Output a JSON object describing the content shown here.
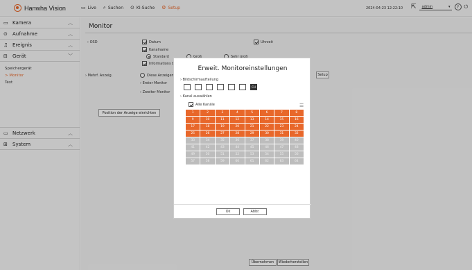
{
  "app": {
    "logo_text": "Hanwha Vision",
    "brand_color": "#e8672a"
  },
  "topmenu": [
    {
      "label": "Live",
      "icon": "monitor-icon"
    },
    {
      "label": "Suchen",
      "icon": "search-icon"
    },
    {
      "label": "KI-Suche",
      "icon": "ai-search-icon"
    },
    {
      "label": "Setup",
      "icon": "gear-icon"
    }
  ],
  "status": {
    "datetime": "2024-04-23 12:22:10",
    "user": "admin"
  },
  "sidebar": {
    "sections": [
      {
        "label": "Kamera",
        "icon": "camera-icon",
        "chevron": "^"
      },
      {
        "label": "Aufnahme",
        "icon": "record-icon",
        "chevron": "^"
      },
      {
        "label": "Ereignis",
        "icon": "bell-icon",
        "chevron": "^"
      },
      {
        "label": "Gerät",
        "icon": "device-icon",
        "chevron": "v"
      },
      {
        "label": "Netzwerk",
        "icon": "network-icon",
        "chevron": "^"
      },
      {
        "label": "System",
        "icon": "system-icon",
        "chevron": "^"
      }
    ],
    "sub": [
      "Speichergerät",
      "> Monitor",
      "Text"
    ]
  },
  "page": {
    "title": "Monitor",
    "osd_label": "› OSD",
    "datum": "Datum",
    "uhrzeit": "Uhrzeit",
    "kanalname": "Kanalname",
    "standard": "Standard",
    "gross": "Groß",
    "sehr_gross": "Sehr groß",
    "informationen": "Informations b",
    "mehrf_label": "› Mehrf. Anzeig.",
    "diese": "Diese Anzeigen b",
    "erster": "› Erster Monitor",
    "zweiter": "› Zweiter Monitor",
    "setup_btn": "Setup",
    "position_btn": "Position der Anzeige einrichten",
    "apply_btn": "Übernehmen",
    "restore_btn": "Wiederherstellen"
  },
  "modal": {
    "title": "Erweit. Monitoreinstellungen",
    "bildschirm": "› Bildschirmaufteilung",
    "kanal": "› Kanal auswählen",
    "alle": "Alle Kanäle",
    "ok": "Ok",
    "abbr": "Abbr.",
    "splits": [
      "",
      "",
      "",
      "",
      "",
      "",
      "CH"
    ],
    "channels_selected": [
      "1",
      "2",
      "3",
      "4",
      "5",
      "6",
      "7",
      "8",
      "9",
      "10",
      "11",
      "12",
      "13",
      "14",
      "15",
      "16",
      "17",
      "18",
      "19",
      "20",
      "21",
      "22",
      "23",
      "24",
      "25",
      "26",
      "27",
      "28",
      "29",
      "30",
      "31",
      "32"
    ],
    "channels_unselected": [
      "33",
      "34",
      "35",
      "36",
      "37",
      "38",
      "39",
      "40",
      "41",
      "42",
      "43",
      "44",
      "45",
      "46",
      "47",
      "48",
      "49",
      "50",
      "51",
      "52",
      "53",
      "54",
      "55",
      "56",
      "57",
      "58",
      "59",
      "60",
      "61",
      "62",
      "63",
      "64"
    ]
  }
}
